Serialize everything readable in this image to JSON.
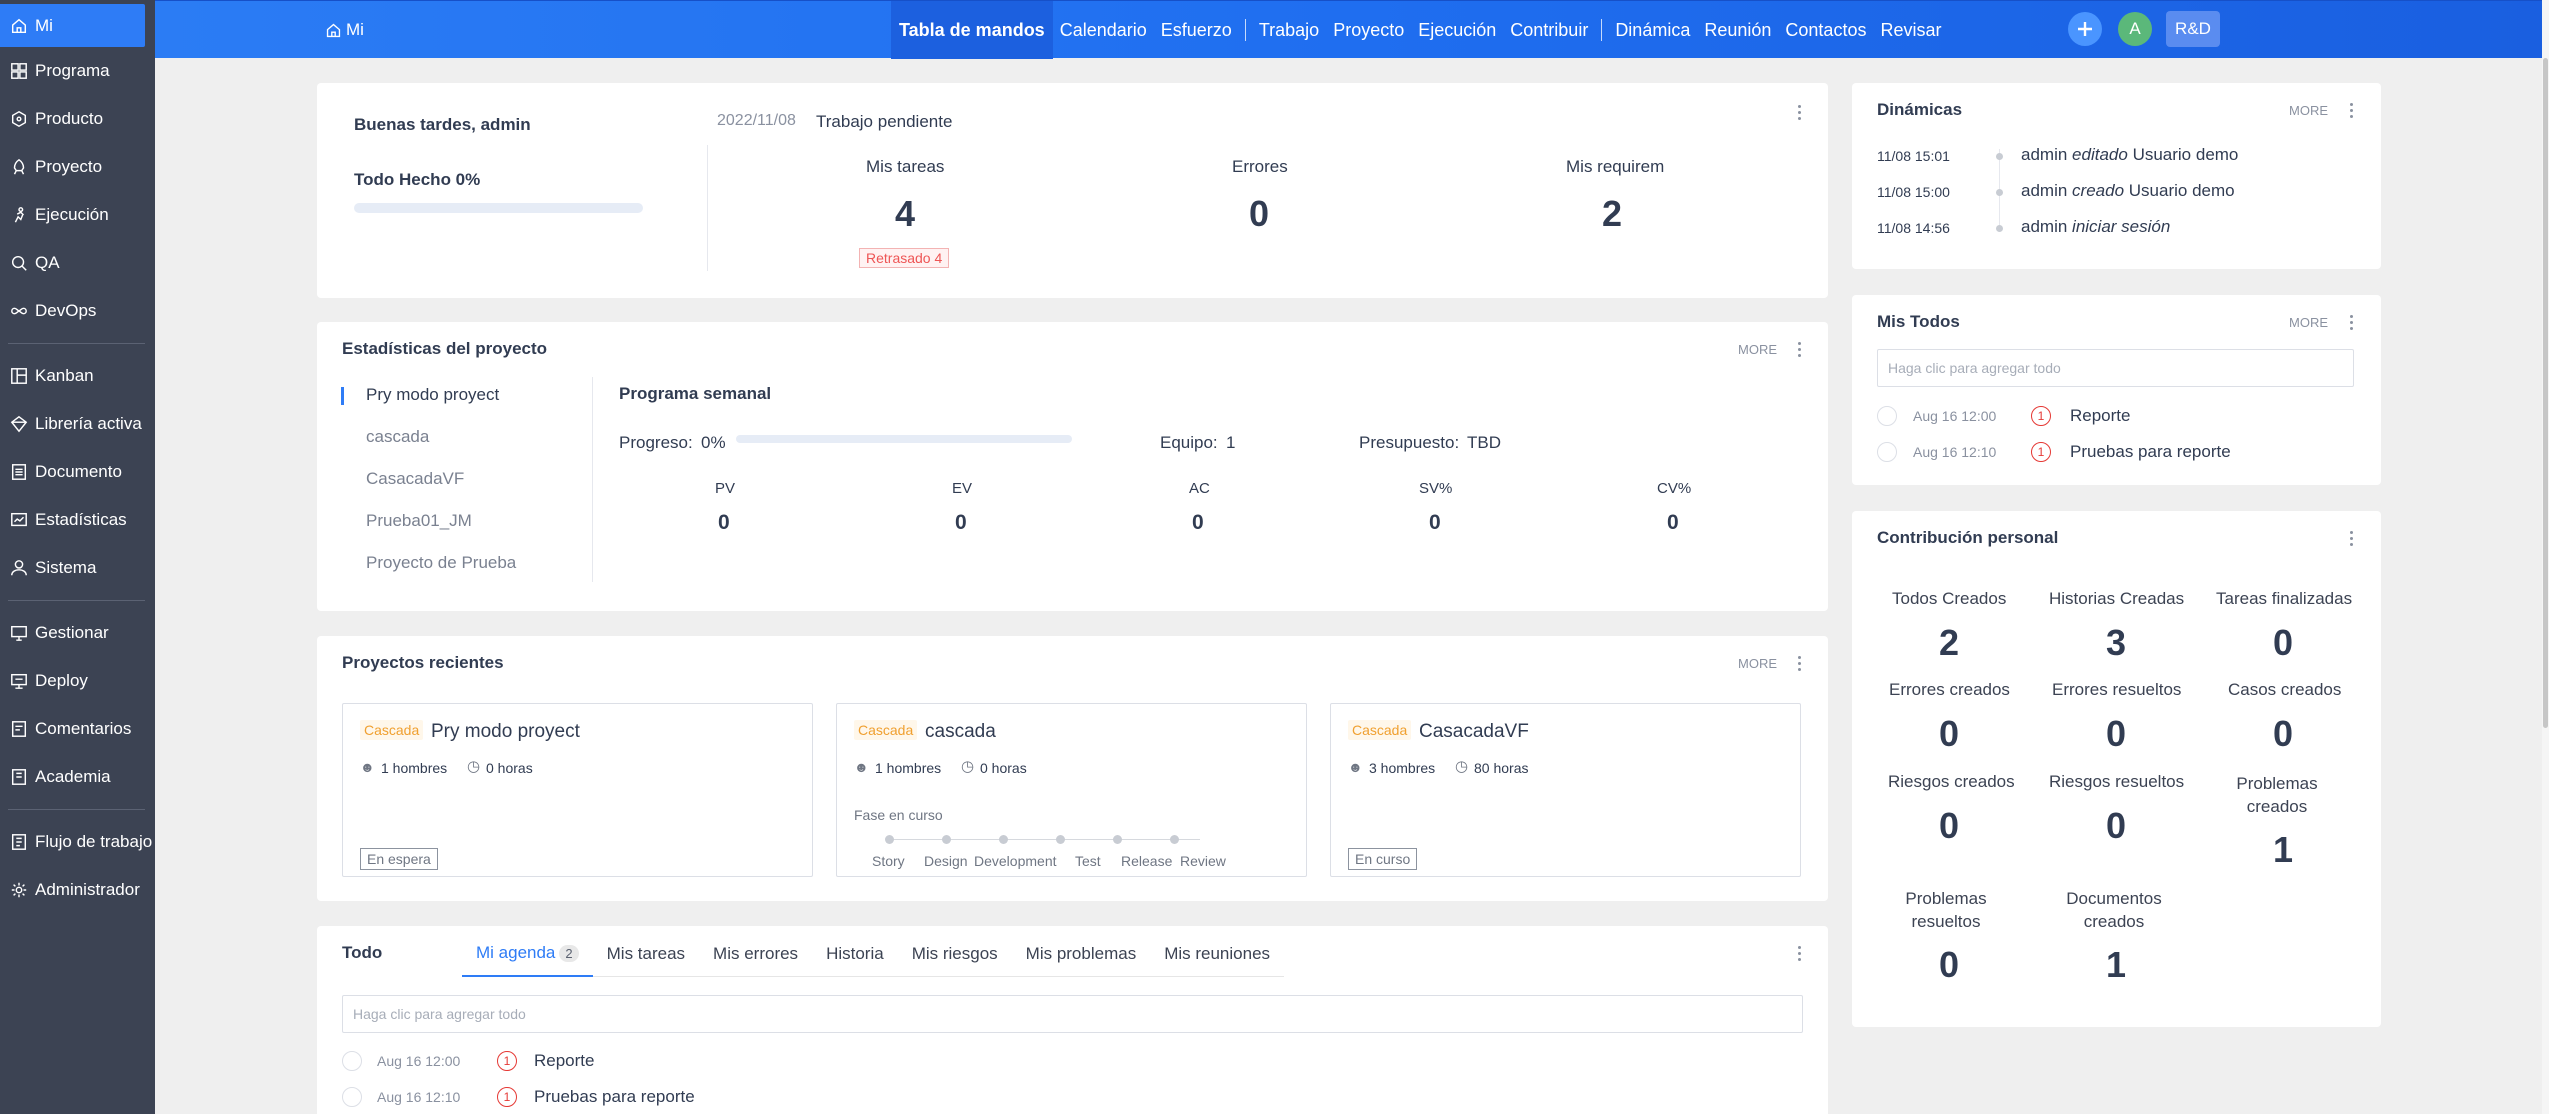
{
  "sidebar": {
    "items": [
      {
        "label": "Mi",
        "icon": "home-icon",
        "active": true
      },
      {
        "label": "Programa",
        "icon": "program-icon"
      },
      {
        "label": "Producto",
        "icon": "product-icon"
      },
      {
        "label": "Proyecto",
        "icon": "project-icon"
      },
      {
        "label": "Ejecución",
        "icon": "execution-icon"
      },
      {
        "label": "QA",
        "icon": "qa-icon"
      },
      {
        "label": "DevOps",
        "icon": "devops-icon"
      },
      {
        "label": "Kanban",
        "icon": "kanban-icon"
      },
      {
        "label": "Librería activa",
        "icon": "library-icon"
      },
      {
        "label": "Documento",
        "icon": "document-icon"
      },
      {
        "label": "Estadísticas",
        "icon": "statistics-icon"
      },
      {
        "label": "Sistema",
        "icon": "system-icon"
      },
      {
        "label": "Gestionar",
        "icon": "manage-icon"
      },
      {
        "label": "Deploy",
        "icon": "deploy-icon"
      },
      {
        "label": "Comentarios",
        "icon": "comments-icon"
      },
      {
        "label": "Academia",
        "icon": "academy-icon"
      },
      {
        "label": "Flujo de trabajo",
        "icon": "workflow-icon"
      },
      {
        "label": "Administrador",
        "icon": "admin-icon"
      }
    ]
  },
  "topbar": {
    "home_label": "Mi",
    "nav": [
      {
        "label": "Tabla de mandos",
        "active": true
      },
      {
        "label": "Calendario"
      },
      {
        "label": "Esfuerzo"
      },
      {
        "label": "Trabajo"
      },
      {
        "label": "Proyecto"
      },
      {
        "label": "Ejecución"
      },
      {
        "label": "Contribuir"
      },
      {
        "label": "Dinámica"
      },
      {
        "label": "Reunión"
      },
      {
        "label": "Contactos"
      },
      {
        "label": "Revisar"
      }
    ],
    "avatar_letter": "A",
    "rd_label": "R&D",
    "accent": "#2e7cf6"
  },
  "welcome": {
    "greeting": "Buenas tardes, admin",
    "date": "2022/11/08",
    "pending_label": "Trabajo pendiente",
    "todo_done": "Todo Hecho 0%",
    "todo_done_fraction": 0,
    "stats": [
      {
        "label": "Mis tareas",
        "value": "4"
      },
      {
        "label": "Errores",
        "value": "0"
      },
      {
        "label": "Mis requirem",
        "value": "2"
      }
    ],
    "delayed": "Retrasado 4"
  },
  "project_stats": {
    "title": "Estadísticas del proyecto",
    "more": "MORE",
    "projects": [
      "Pry modo proyect",
      "cascada",
      "CasacadaVF",
      "Prueba01_JM",
      "Proyecto de Prueba"
    ],
    "selected_title": "Programa semanal",
    "progress_label": "Progreso:",
    "progress_value": "0%",
    "team_label": "Equipo:",
    "team_value": "1",
    "budget_label": "Presupuesto:",
    "budget_value": "TBD",
    "metrics": [
      {
        "label": "PV",
        "value": "0"
      },
      {
        "label": "EV",
        "value": "0"
      },
      {
        "label": "AC",
        "value": "0"
      },
      {
        "label": "SV%",
        "value": "0"
      },
      {
        "label": "CV%",
        "value": "0"
      }
    ]
  },
  "recent": {
    "title": "Proyectos recientes",
    "more": "MORE",
    "projects": [
      {
        "tag": "Cascada",
        "name": "Pry modo proyect",
        "people": "1 hombres",
        "hours": "0 horas",
        "status": "En espera"
      },
      {
        "tag": "Cascada",
        "name": "cascada",
        "people": "1 hombres",
        "hours": "0 horas",
        "phase_label": "Fase en curso",
        "phases": [
          "Story",
          "Design",
          "Development",
          "Test",
          "Release",
          "Review"
        ]
      },
      {
        "tag": "Cascada",
        "name": "CasacadaVF",
        "people": "3 hombres",
        "hours": "80 horas",
        "status": "En curso"
      }
    ]
  },
  "todo": {
    "title": "Todo",
    "tabs": [
      {
        "label": "Mi agenda",
        "count": "2",
        "active": true
      },
      {
        "label": "Mis tareas"
      },
      {
        "label": "Mis errores"
      },
      {
        "label": "Historia"
      },
      {
        "label": "Mis riesgos"
      },
      {
        "label": "Mis problemas"
      },
      {
        "label": "Mis reuniones"
      }
    ],
    "placeholder": "Haga clic para agregar todo",
    "items": [
      {
        "time": "Aug 16 12:00",
        "priority": "1",
        "name": "Reporte"
      },
      {
        "time": "Aug 16 12:10",
        "priority": "1",
        "name": "Pruebas para reporte"
      }
    ]
  },
  "dynamics": {
    "title": "Dinámicas",
    "more": "MORE",
    "items": [
      {
        "time": "11/08 15:01",
        "user": "admin",
        "action": "editado",
        "object": "Usuario demo"
      },
      {
        "time": "11/08 15:00",
        "user": "admin",
        "action": "creado",
        "object": "Usuario demo"
      },
      {
        "time": "11/08 14:56",
        "user": "admin",
        "action": "iniciar sesión",
        "object": ""
      }
    ]
  },
  "my_todos": {
    "title": "Mis Todos",
    "more": "MORE",
    "placeholder": "Haga clic para agregar todo",
    "items": [
      {
        "time": "Aug 16 12:00",
        "priority": "1",
        "name": "Reporte"
      },
      {
        "time": "Aug 16 12:10",
        "priority": "1",
        "name": "Pruebas para reporte"
      }
    ]
  },
  "contribution": {
    "title": "Contribución personal",
    "items": [
      {
        "label": "Todos Creados",
        "value": "2"
      },
      {
        "label": "Historias Creadas",
        "value": "3"
      },
      {
        "label": "Tareas finalizadas",
        "value": "0"
      },
      {
        "label": "Errores creados",
        "value": "0"
      },
      {
        "label": "Errores resueltos",
        "value": "0"
      },
      {
        "label": "Casos creados",
        "value": "0"
      },
      {
        "label": "Riesgos creados",
        "value": "0"
      },
      {
        "label": "Riesgos resueltos",
        "value": "0"
      },
      {
        "label": "Problemas creados",
        "value": "1"
      },
      {
        "label": "Problemas resueltos",
        "value": "0"
      },
      {
        "label": "Documentos creados",
        "value": "1"
      }
    ]
  }
}
